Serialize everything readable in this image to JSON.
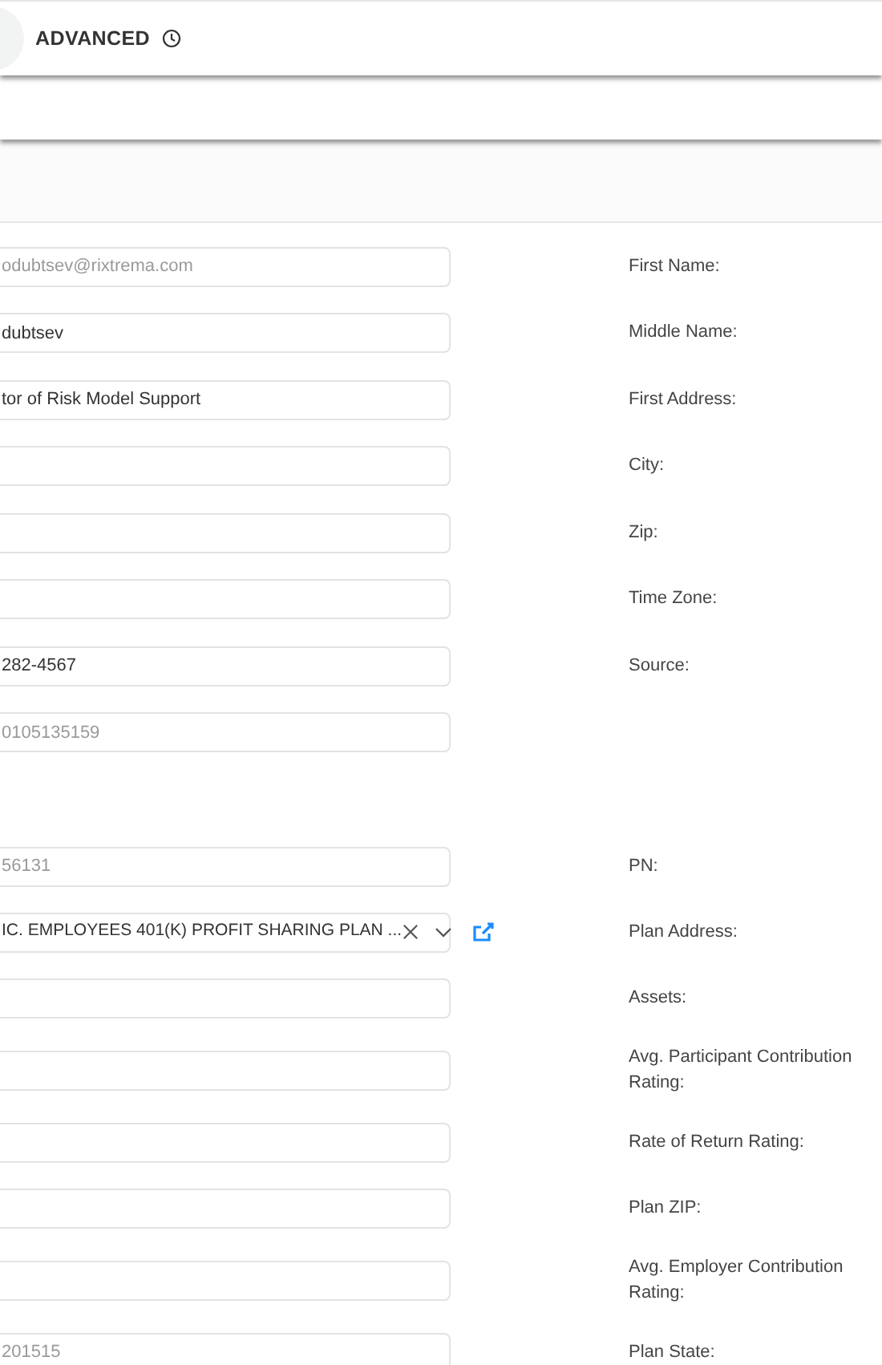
{
  "header": {
    "title": "ADVANCED"
  },
  "sections": [
    {
      "rows": [
        {
          "kind": "text",
          "value": "odubtsev@rixtrema.com",
          "disabled": true,
          "label": "First Name:"
        },
        {
          "kind": "text",
          "value": "dubtsev",
          "disabled": false,
          "label": "Middle Name:"
        },
        {
          "kind": "text",
          "value": "tor of Risk Model Support",
          "disabled": false,
          "label": "First Address:"
        },
        {
          "kind": "text",
          "label": "City:"
        },
        {
          "kind": "text",
          "label": "Zip:"
        },
        {
          "kind": "text",
          "label": "Time Zone:"
        },
        {
          "kind": "text",
          "value": "282-4567",
          "disabled": false,
          "label": "Source:"
        },
        {
          "kind": "text",
          "value": "0105135159",
          "disabled": true
        }
      ]
    },
    {
      "rows": [
        {
          "kind": "text",
          "value": "56131",
          "disabled": true,
          "label": "PN:"
        },
        {
          "kind": "select",
          "value": "IC. EMPLOYEES 401(K) PROFIT SHARING PLAN ...",
          "label": "Plan Address:"
        },
        {
          "kind": "text",
          "label": "Assets:"
        },
        {
          "kind": "text",
          "label": "Avg. Participant Contribution Rating:"
        },
        {
          "kind": "text",
          "label": "Rate of Return Rating:"
        },
        {
          "kind": "text",
          "label": "Plan ZIP:"
        },
        {
          "kind": "text",
          "label": "Avg. Employer Contribution Rating:"
        },
        {
          "kind": "text",
          "value": "201515",
          "disabled": true,
          "label": "Plan State:"
        }
      ]
    }
  ]
}
